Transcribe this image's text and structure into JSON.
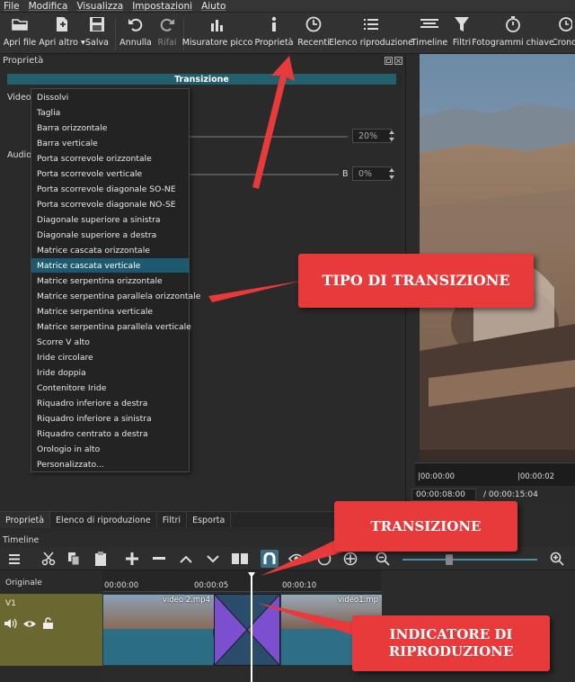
{
  "menubar": [
    "File",
    "Modifica",
    "Visualizza",
    "Impostazioni",
    "Aiuto"
  ],
  "toolbar": {
    "buttons": [
      {
        "label": "Apri file",
        "icon": "open-folder-icon"
      },
      {
        "label": "Apri altro",
        "icon": "open-other-icon"
      },
      {
        "label": "Salva",
        "icon": "save-icon"
      },
      {
        "label": "Annulla",
        "icon": "undo-icon"
      },
      {
        "label": "Rifai",
        "icon": "redo-icon",
        "disabled": true
      },
      {
        "label": "Misuratore picco",
        "icon": "peak-meter-icon"
      },
      {
        "label": "Proprietà",
        "icon": "info-icon"
      },
      {
        "label": "Recenti",
        "icon": "clock-icon"
      },
      {
        "label": "Elenco riproduzione",
        "icon": "playlist-icon"
      },
      {
        "label": "Timeline",
        "icon": "timeline-icon"
      },
      {
        "label": "Filtri",
        "icon": "filter-icon"
      },
      {
        "label": "Fotogrammi chiave",
        "icon": "stopwatch-icon"
      },
      {
        "label": "Crono",
        "icon": "history-icon"
      }
    ]
  },
  "properties": {
    "panel_title": "Proprietà",
    "transition_header": "Transizione",
    "video_label": "Video",
    "audio_label": "Audio",
    "video_pct": "20%",
    "audio_b": "B",
    "audio_pct": "0%"
  },
  "dropdown": {
    "selected_index": 11,
    "items": [
      "Dissolvi",
      "Taglia",
      "Barra orizzontale",
      "Barra verticale",
      "Porta scorrevole orizzontale",
      "Porta scorrevole verticale",
      "Porta scorrevole diagonale SO-NE",
      "Porta scorrevole diagonale NO-SE",
      "Diagonale superiore a sinistra",
      "Diagonale superiore a destra",
      "Matrice cascata orizzontale",
      "Matrice cascata verticale",
      "Matrice serpentina orizzontale",
      "Matrice serpentina parallela orizzontale",
      "Matrice serpentina verticale",
      "Matrice serpentina parallela verticale",
      "Scorre V alto",
      "Iride circolare",
      "Iride doppia",
      "Contenitore Iride",
      "Riquadro inferiore a destra",
      "Riquadro inferiore a sinistra",
      "Riquadro centrato a destra",
      "Orologio in alto",
      "Personalizzato..."
    ]
  },
  "bottom_tabs": [
    "Proprietà",
    "Elenco di riproduzione",
    "Filtri",
    "Esporta"
  ],
  "player": {
    "ruler_start": "|00:00:00",
    "ruler_mark": "|00:00:02",
    "current_time": "00:00:08:00",
    "total_time": "/ 00:00:15:04"
  },
  "timeline": {
    "title": "Timeline",
    "track_header": "Originale",
    "track_name": "V1",
    "ruler": [
      "00:00:00",
      "00:00:05",
      "00:00:10"
    ],
    "clip_left": "video 2.mp4",
    "clip_right": "video1.mp"
  },
  "annotations": {
    "tipo": "TIPO DI TRANSIZIONE",
    "transizione": "TRANSIZIONE",
    "indicatore": "INDICATORE DI RIPRODUZIONE"
  },
  "colors": {
    "accent": "#1d5a70",
    "callout": "#e83a3a",
    "transition_purple": "#7b4fd0",
    "track_olive": "#6a6830"
  }
}
